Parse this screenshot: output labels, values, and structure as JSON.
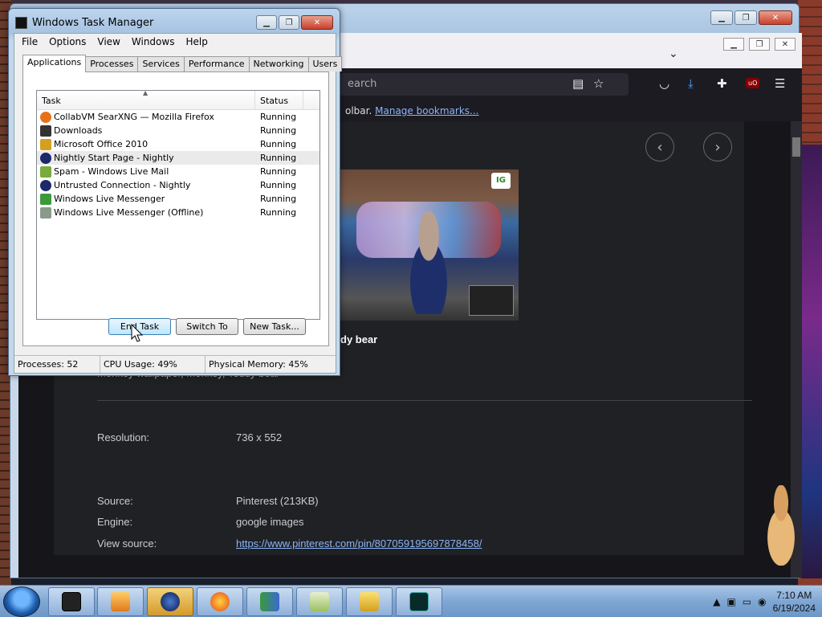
{
  "task_manager": {
    "title": "Windows Task Manager",
    "menu": [
      "File",
      "Options",
      "View",
      "Windows",
      "Help"
    ],
    "tabs": [
      "Applications",
      "Processes",
      "Services",
      "Performance",
      "Networking",
      "Users"
    ],
    "columns": {
      "task": "Task",
      "status": "Status"
    },
    "tasks": [
      {
        "name": "CollabVM SearXNG — Mozilla Firefox",
        "status": "Running",
        "icon": "firefox-icon",
        "color": "#e8701a"
      },
      {
        "name": "Downloads",
        "status": "Running",
        "icon": "downloads-icon",
        "color": "#333333"
      },
      {
        "name": "Microsoft Office 2010",
        "status": "Running",
        "icon": "office-icon",
        "color": "#d4a020"
      },
      {
        "name": "Nightly Start Page - Nightly",
        "status": "Running",
        "icon": "nightly-icon",
        "color": "#1a2a6a"
      },
      {
        "name": "Spam - Windows Live Mail",
        "status": "Running",
        "icon": "mail-icon",
        "color": "#7aaa3a"
      },
      {
        "name": "Untrusted Connection - Nightly",
        "status": "Running",
        "icon": "nightly-icon",
        "color": "#1a2a6a"
      },
      {
        "name": "Windows Live Messenger",
        "status": "Running",
        "icon": "messenger-icon",
        "color": "#3a9a3a"
      },
      {
        "name": "Windows Live Messenger (Offline)",
        "status": "Running",
        "icon": "messenger-offline-icon",
        "color": "#8a9a8a"
      }
    ],
    "buttons": {
      "end_task": "End Task",
      "switch_to": "Switch To",
      "new_task": "New Task..."
    },
    "status": {
      "processes": "Processes: 52",
      "cpu": "CPU Usage: 49%",
      "memory": "Physical Memory: 45%"
    }
  },
  "browser": {
    "url_placeholder": "earch",
    "bookmarks_text": "olbar.",
    "bookmarks_link": "Manage bookmarks...",
    "image_title": "dy bear",
    "image_tags": "Monkey wallpaper, Monkey, Teddy bear",
    "meta": [
      {
        "key": "Resolution:",
        "value": "736 x 552"
      },
      {
        "key": "Source:",
        "value": "Pinterest (213KB)"
      },
      {
        "key": "Engine:",
        "value": "google images"
      },
      {
        "key": "View source:",
        "value": "https://www.pinterest.com/pin/807059195697878458/"
      }
    ],
    "photo_logo": "IG"
  },
  "taskbar": {
    "time": "7:10 AM",
    "date": "6/19/2024",
    "tray_chevron": "▲"
  },
  "colors": {
    "taskbar": "#7fa7d3",
    "link": "#8ab4f8",
    "page_bg": "#202124"
  }
}
